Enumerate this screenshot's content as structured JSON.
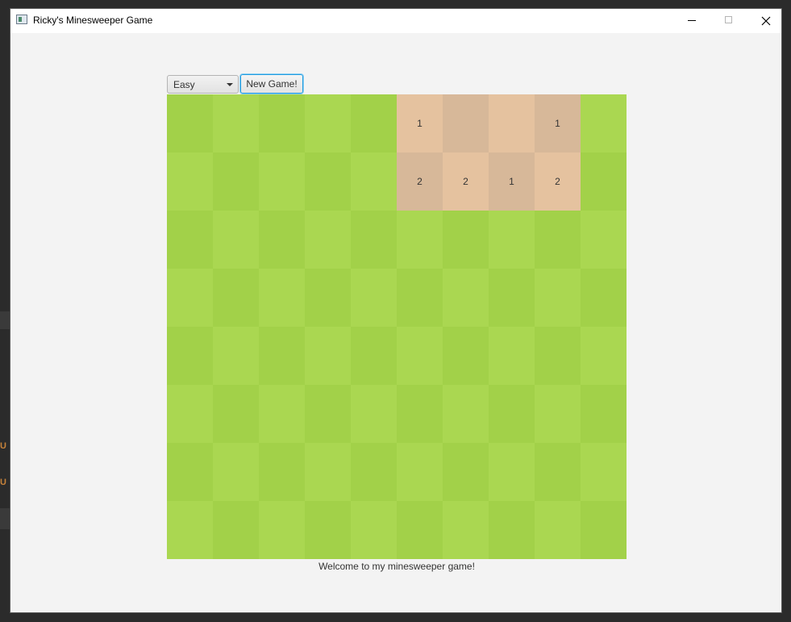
{
  "window": {
    "title": "Ricky's Minesweeper Game"
  },
  "toolbar": {
    "difficulty": {
      "selected": "Easy"
    },
    "new_game_label": "New Game!"
  },
  "board": {
    "rows": 8,
    "cols": 10,
    "colors": {
      "grass_light": "#aad751",
      "grass_dark": "#a2d149",
      "dirt_light": "#e5c29f",
      "dirt_dark": "#d7b899"
    },
    "revealed": [
      {
        "row": 0,
        "col": 5,
        "label": "1"
      },
      {
        "row": 0,
        "col": 6,
        "label": ""
      },
      {
        "row": 0,
        "col": 7,
        "label": ""
      },
      {
        "row": 0,
        "col": 8,
        "label": "1"
      },
      {
        "row": 1,
        "col": 5,
        "label": "2"
      },
      {
        "row": 1,
        "col": 6,
        "label": "2"
      },
      {
        "row": 1,
        "col": 7,
        "label": "1"
      },
      {
        "row": 1,
        "col": 8,
        "label": "2"
      }
    ]
  },
  "status_message": "Welcome to my minesweeper game!",
  "background": {
    "glyphs": [
      "U",
      "U"
    ]
  }
}
